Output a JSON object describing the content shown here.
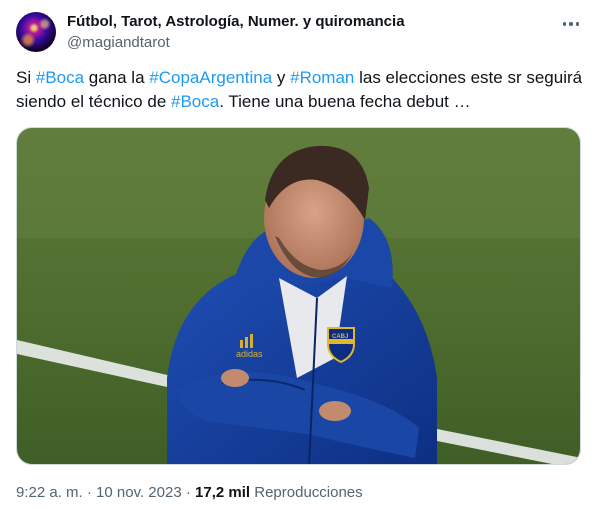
{
  "author": {
    "display_name": "Fútbol, Tarot, Astrología, Numer. y quiromancia",
    "handle": "@magiandtarot"
  },
  "more_icon": "more-horizontal-icon",
  "tweet": {
    "segments": [
      {
        "type": "text",
        "value": "Si "
      },
      {
        "type": "hashtag",
        "value": "#Boca"
      },
      {
        "type": "text",
        "value": " gana la "
      },
      {
        "type": "hashtag",
        "value": "#CopaArgentina"
      },
      {
        "type": "text",
        "value": " y "
      },
      {
        "type": "hashtag",
        "value": "#Roman"
      },
      {
        "type": "text",
        "value": " las elecciones este sr seguirá siendo el técnico de "
      },
      {
        "type": "hashtag",
        "value": "#Boca"
      },
      {
        "type": "text",
        "value": ". Tiene una buena fecha debut …"
      }
    ]
  },
  "media": {
    "kind": "photo",
    "jacket_brand": "adidas",
    "crest_text": "CABJ"
  },
  "meta": {
    "time": "9:22 a. m.",
    "separator": " · ",
    "date": "10 nov. 2023",
    "views_count": "17,2 mil",
    "views_label": "Reproducciones"
  },
  "colors": {
    "link": "#1d9bf0",
    "secondary_text": "#536471",
    "primary_text": "#0f1419"
  }
}
